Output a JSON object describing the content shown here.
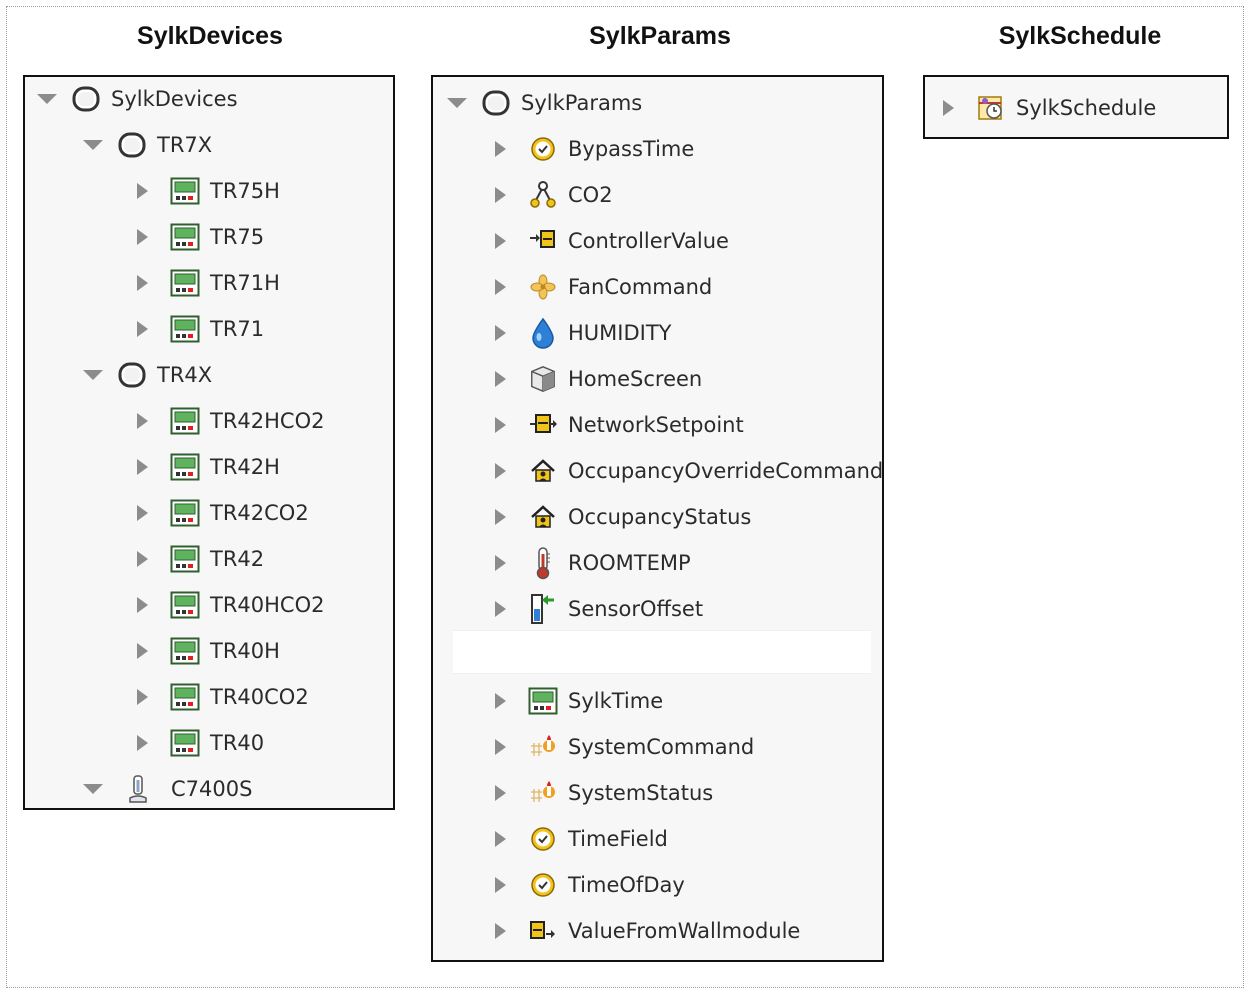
{
  "titles": {
    "devices": "SylkDevices",
    "params": "SylkParams",
    "schedule": "SylkSchedule"
  },
  "devices_tree": {
    "root": "SylkDevices",
    "group_tr7x": "TR7X",
    "tr7x_items": [
      "TR75H",
      "TR75",
      "TR71H",
      "TR71"
    ],
    "group_tr4x": "TR4X",
    "tr4x_items": [
      "TR42HCO2",
      "TR42H",
      "TR42CO2",
      "TR42",
      "TR40HCO2",
      "TR40H",
      "TR40CO2",
      "TR40"
    ],
    "c7400s": "C7400S"
  },
  "params_tree": {
    "root": "SylkParams",
    "items": [
      {
        "label": "BypassTime",
        "icon": "clock-icon"
      },
      {
        "label": "CO2",
        "icon": "molecule-icon"
      },
      {
        "label": "ControllerValue",
        "icon": "input-arrow-icon"
      },
      {
        "label": "FanCommand",
        "icon": "fan-icon"
      },
      {
        "label": "HUMIDITY",
        "icon": "water-drop-icon"
      },
      {
        "label": "HomeScreen",
        "icon": "cube-icon"
      },
      {
        "label": "NetworkSetpoint",
        "icon": "setpoint-icon"
      },
      {
        "label": "OccupancyOverrideCommand",
        "icon": "house-icon"
      },
      {
        "label": "OccupancyStatus",
        "icon": "house-icon"
      },
      {
        "label": "ROOMTEMP",
        "icon": "thermometer-icon"
      },
      {
        "label": "SensorOffset",
        "icon": "sensor-offset-icon"
      }
    ],
    "items_after_gap": [
      {
        "label": "SylkTime",
        "icon": "device-icon"
      },
      {
        "label": "SystemCommand",
        "icon": "system-icon"
      },
      {
        "label": "SystemStatus",
        "icon": "system-icon"
      },
      {
        "label": "TimeField",
        "icon": "clock-icon"
      },
      {
        "label": "TimeOfDay",
        "icon": "clock-icon"
      },
      {
        "label": "ValueFromWallmodule",
        "icon": "output-arrow-icon"
      }
    ]
  },
  "schedule_tree": {
    "root": "SylkSchedule"
  },
  "colors": {
    "border": "#111111",
    "triangle": "#8c8c8c",
    "device_green": "#3a8a3a",
    "clock_yellow": "#f0c419",
    "drop_blue": "#2e7fd6"
  }
}
